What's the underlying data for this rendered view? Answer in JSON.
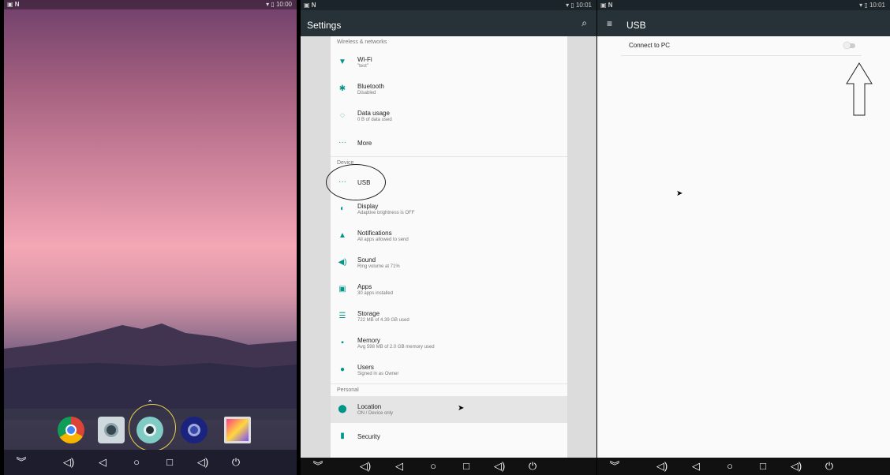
{
  "home": {
    "status_left": "▣ N",
    "status_time": "10:00",
    "dock_apps": [
      "chrome-icon",
      "camera-icon",
      "settings-icon",
      "music-icon",
      "gallery-icon"
    ]
  },
  "settings": {
    "status_left": "▣ N",
    "status_time": "10:01",
    "title": "Settings",
    "categories": {
      "wireless": "Wireless & networks",
      "device": "Device",
      "personal": "Personal"
    },
    "items": {
      "wifi": {
        "title": "Wi-Fi",
        "summary": "\"test\""
      },
      "bluetooth": {
        "title": "Bluetooth",
        "summary": "Disabled"
      },
      "data_usage": {
        "title": "Data usage",
        "summary": "0 B of data used"
      },
      "more": {
        "title": "More"
      },
      "usb": {
        "title": "USB"
      },
      "display": {
        "title": "Display",
        "summary": "Adaptive brightness is OFF"
      },
      "notifications": {
        "title": "Notifications",
        "summary": "All apps allowed to send"
      },
      "sound": {
        "title": "Sound",
        "summary": "Ring volume at 71%"
      },
      "apps": {
        "title": "Apps",
        "summary": "30 apps installed"
      },
      "storage": {
        "title": "Storage",
        "summary": "722 MB of 4.39 GB used"
      },
      "memory": {
        "title": "Memory",
        "summary": "Avg 598 MB of 2.0 GB memory used"
      },
      "users": {
        "title": "Users",
        "summary": "Signed in as Owner"
      },
      "location": {
        "title": "Location",
        "summary": "ON / Device only"
      },
      "security": {
        "title": "Security"
      }
    }
  },
  "usb": {
    "status_left": "▣ N",
    "status_time": "10:01",
    "title": "USB",
    "connect_label": "Connect to PC"
  }
}
